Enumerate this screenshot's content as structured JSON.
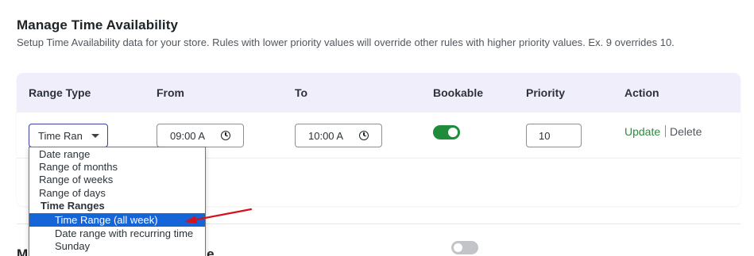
{
  "header": {
    "title": "Manage Time Availability",
    "description": "Setup Time Availability data for your store. Rules with lower priority values will override other rules with higher priority values. Ex. 9 overrides 10."
  },
  "table": {
    "columns": {
      "range_type": "Range Type",
      "from": "From",
      "to": "To",
      "bookable": "Bookable",
      "priority": "Priority",
      "action": "Action"
    },
    "row": {
      "range_type_value": "Time Ran",
      "from_value": "09:00 A",
      "to_value": "10:00 A",
      "bookable": true,
      "priority_value": "10",
      "update_label": "Update",
      "delete_label": "Delete"
    }
  },
  "dropdown": {
    "options": {
      "date_range": "Date range",
      "range_of_months": "Range of months",
      "range_of_weeks": "Range of weeks",
      "range_of_days": "Range of days",
      "group_time_ranges": "Time Ranges",
      "time_range_all_week": "Time Range (all week)",
      "date_range_recurring": "Date range with recurring time",
      "sunday": "Sunday"
    },
    "selected": "Time Range (all week)"
  },
  "section2": {
    "label_start": "M",
    "label_end": "e",
    "toggle_on": false
  },
  "colors": {
    "accent": "#3c3fa3",
    "header_bg": "#f1eefc",
    "toggle_on": "#1e8c3a",
    "update_link": "#2e8b3f",
    "selection": "#1565d8",
    "annotation_arrow": "#d4121a"
  },
  "icons": {
    "time_input": "clock-icon",
    "select": "chevron-down-icon",
    "annotation": "red-arrow-annotation"
  }
}
